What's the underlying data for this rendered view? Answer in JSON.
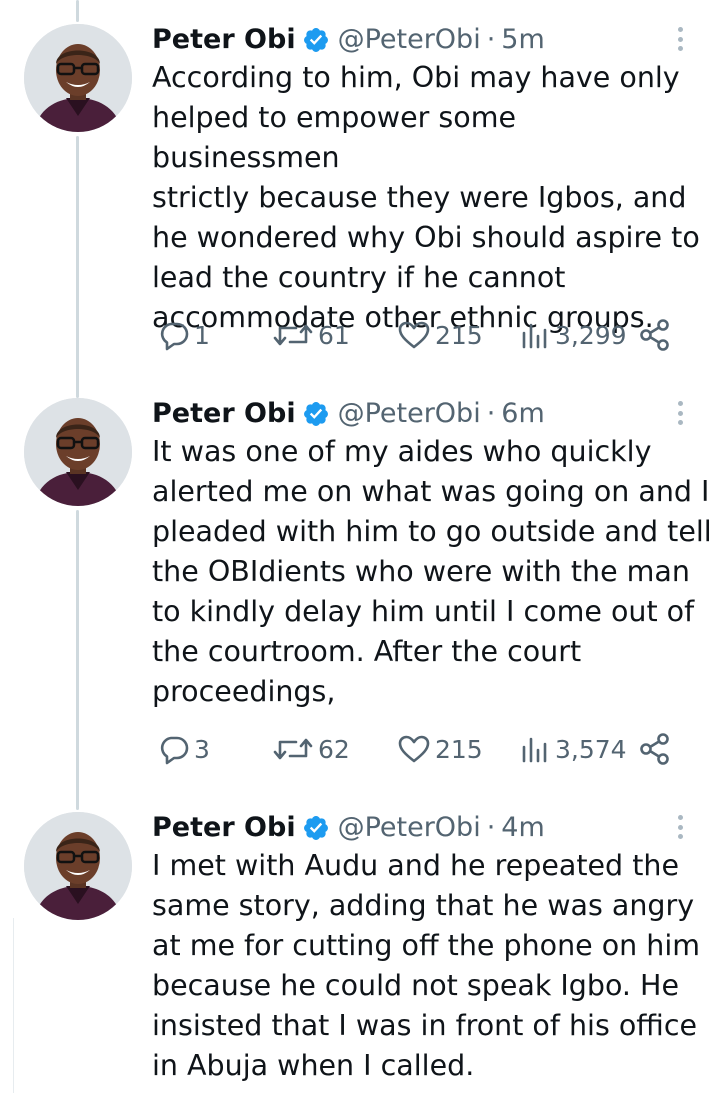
{
  "tweets": [
    {
      "name": "Peter Obi",
      "handle": "@PeterObi",
      "separator": "·",
      "time": "5m",
      "text": "According to him, Obi may have only\nhelped to empower some businessmen\nstrictly because they were Igbos, and\nhe wondered why Obi should aspire to\nlead the country if he cannot\naccommodate other ethnic groups.",
      "replies": "1",
      "retweets": "61",
      "likes": "215",
      "views": "3,299"
    },
    {
      "name": "Peter Obi",
      "handle": "@PeterObi",
      "separator": "·",
      "time": "6m",
      "text": "It was one of my aides who quickly\nalerted me on what was going on and I\npleaded with him to go outside and tell\nthe OBIdients who were with the man\nto kindly delay him until I come out of\nthe courtroom. After the court\nproceedings,",
      "replies": "3",
      "retweets": "62",
      "likes": "215",
      "views": "3,574"
    },
    {
      "name": "Peter Obi",
      "handle": "@PeterObi",
      "separator": "·",
      "time": "4m",
      "text": "I met with Audu and he repeated the\nsame story, adding that he was angry\nat me for cutting off the phone on him\nbecause he could not speak Igbo. He\ninsisted that I was in front of his office\nin Abuja when I called."
    }
  ],
  "icons": {
    "reply": "speech-bubble-icon",
    "retweet": "retweet-arrows-icon",
    "like": "heart-icon",
    "views": "bar-chart-icon",
    "share": "share-nodes-icon",
    "more": "vertical-ellipsis-icon",
    "verified": "verified-badge-icon"
  },
  "colors": {
    "verified": "#1d9bf0",
    "text": "#0f1419",
    "muted": "#536471",
    "thread_line": "#cfd9de"
  }
}
